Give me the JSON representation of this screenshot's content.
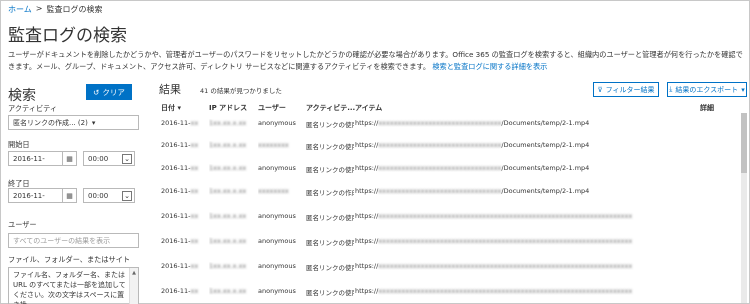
{
  "breadcrumb": {
    "home": "ホーム",
    "sep": ">",
    "current": "監査ログの検索"
  },
  "title": "監査ログの検索",
  "description": {
    "text": "ユーザーがドキュメントを削除したかどうかや、管理者がユーザーのパスワードをリセットしたかどうかの確認が必要な場合があります。Office 365 の監査ログを検索すると、組織内のユーザーと管理者が何を行ったかを確認できます。メール、グループ、ドキュメント、アクセス許可、ディレクトリ サービスなどに関連するアクティビティを検索できます。",
    "link": "検索と監査ログに関する詳細を表示"
  },
  "search": {
    "title": "検索",
    "clear_label": "クリア",
    "activity_label": "アクティビティ",
    "activity_value": "匿名リンクの作成... (2)",
    "start_label": "開始日",
    "start_date": "2016-11-",
    "start_time": "00:00",
    "end_label": "終了日",
    "end_date": "2016-11-",
    "end_time": "00:00",
    "users_label": "ユーザー",
    "users_placeholder": "すべてのユーザーの結果を表示",
    "file_label": "ファイル、フォルダー、またはサイト",
    "file_placeholder": "ファイル名、フォルダー名、または URL のすべてまたは一部を追加してください。次の文字はスペースに置き換"
  },
  "results": {
    "title": "結果",
    "count": "41 の結果が見つかりました",
    "filter_label": "フィルター結果",
    "export_label": "結果のエクスポート",
    "columns": {
      "date": "日付",
      "ip": "IP アドレス",
      "user": "ユーザー",
      "activity": "アクティビテ...",
      "item": "アイテム",
      "detail": "詳細"
    },
    "rows": [
      {
        "date": "2016-11-",
        "ip": "1xx.xx.x.xx",
        "user": "anonymous",
        "activity": "匿名リンクの使用",
        "item_prefix": "https://",
        "item_mid": "xxxxxxxxxxxxxxxxxxxxxxxxxxxxxxxx",
        "item_suffix": "/Documents/temp/2-1.mp4"
      },
      {
        "date": "2016-11-",
        "ip": "1xx.xx.x.xx",
        "user": "xxxxxxxx",
        "activity": "匿名リンクの使用",
        "item_prefix": "https://",
        "item_mid": "xxxxxxxxxxxxxxxxxxxxxxxxxxxxxxxx",
        "item_suffix": "/Documents/temp/2-1.mp4"
      },
      {
        "date": "2016-11-",
        "ip": "1xx.xx.x.xx",
        "user": "anonymous",
        "activity": "匿名リンクの使用",
        "item_prefix": "https://",
        "item_mid": "xxxxxxxxxxxxxxxxxxxxxxxxxxxxxxxx",
        "item_suffix": "/Documents/temp/2-1.mp4"
      },
      {
        "date": "2016-11-",
        "ip": "1xx.xx.x.xx",
        "user": "xxxxxxxx",
        "activity": "匿名リンクの作成",
        "item_prefix": "https://",
        "item_mid": "xxxxxxxxxxxxxxxxxxxxxxxxxxxxxxxx",
        "item_suffix": "/Documents/temp/2-1.mp4"
      },
      {
        "date": "2016-11-",
        "ip": "1xx.xx.x.xx",
        "user": "anonymous",
        "activity": "匿名リンクの使用",
        "item_prefix": "https://",
        "item_mid": "xxxxxxxxxxxxxxxxxxxxxxxxxxxxxxxxxxxxxxxxxxxxxxxxxxxxxxxxxxxxxxxxxx",
        "item_suffix": ""
      },
      {
        "date": "2016-11-",
        "ip": "1xx.xx.x.xx",
        "user": "anonymous",
        "activity": "匿名リンクの使用",
        "item_prefix": "https://",
        "item_mid": "xxxxxxxxxxxxxxxxxxxxxxxxxxxxxxxxxxxxxxxxxxxxxxxxxxxxxxxxxxxxxxxxxx",
        "item_suffix": ""
      },
      {
        "date": "2016-11-",
        "ip": "1xx.xx.x.xx",
        "user": "anonymous",
        "activity": "匿名リンクの使用",
        "item_prefix": "https://",
        "item_mid": "xxxxxxxxxxxxxxxxxxxxxxxxxxxxxxxxxxxxxxxxxxxxxxxxxxxxxxxxxxxxxxxxxx",
        "item_suffix": ""
      },
      {
        "date": "2016-11-",
        "ip": "1xx.xx.x.xx",
        "user": "anonymous",
        "activity": "匿名リンクの使用",
        "item_prefix": "https://",
        "item_mid": "xxxxxxxxxxxxxxxxxxxxxxxxxxxxxxxxxxxxxxxxxxxxxxxxxxxxxxxxxxxxxxxxxx",
        "item_suffix": ""
      }
    ]
  },
  "colors": {
    "accent": "#0072c6"
  }
}
